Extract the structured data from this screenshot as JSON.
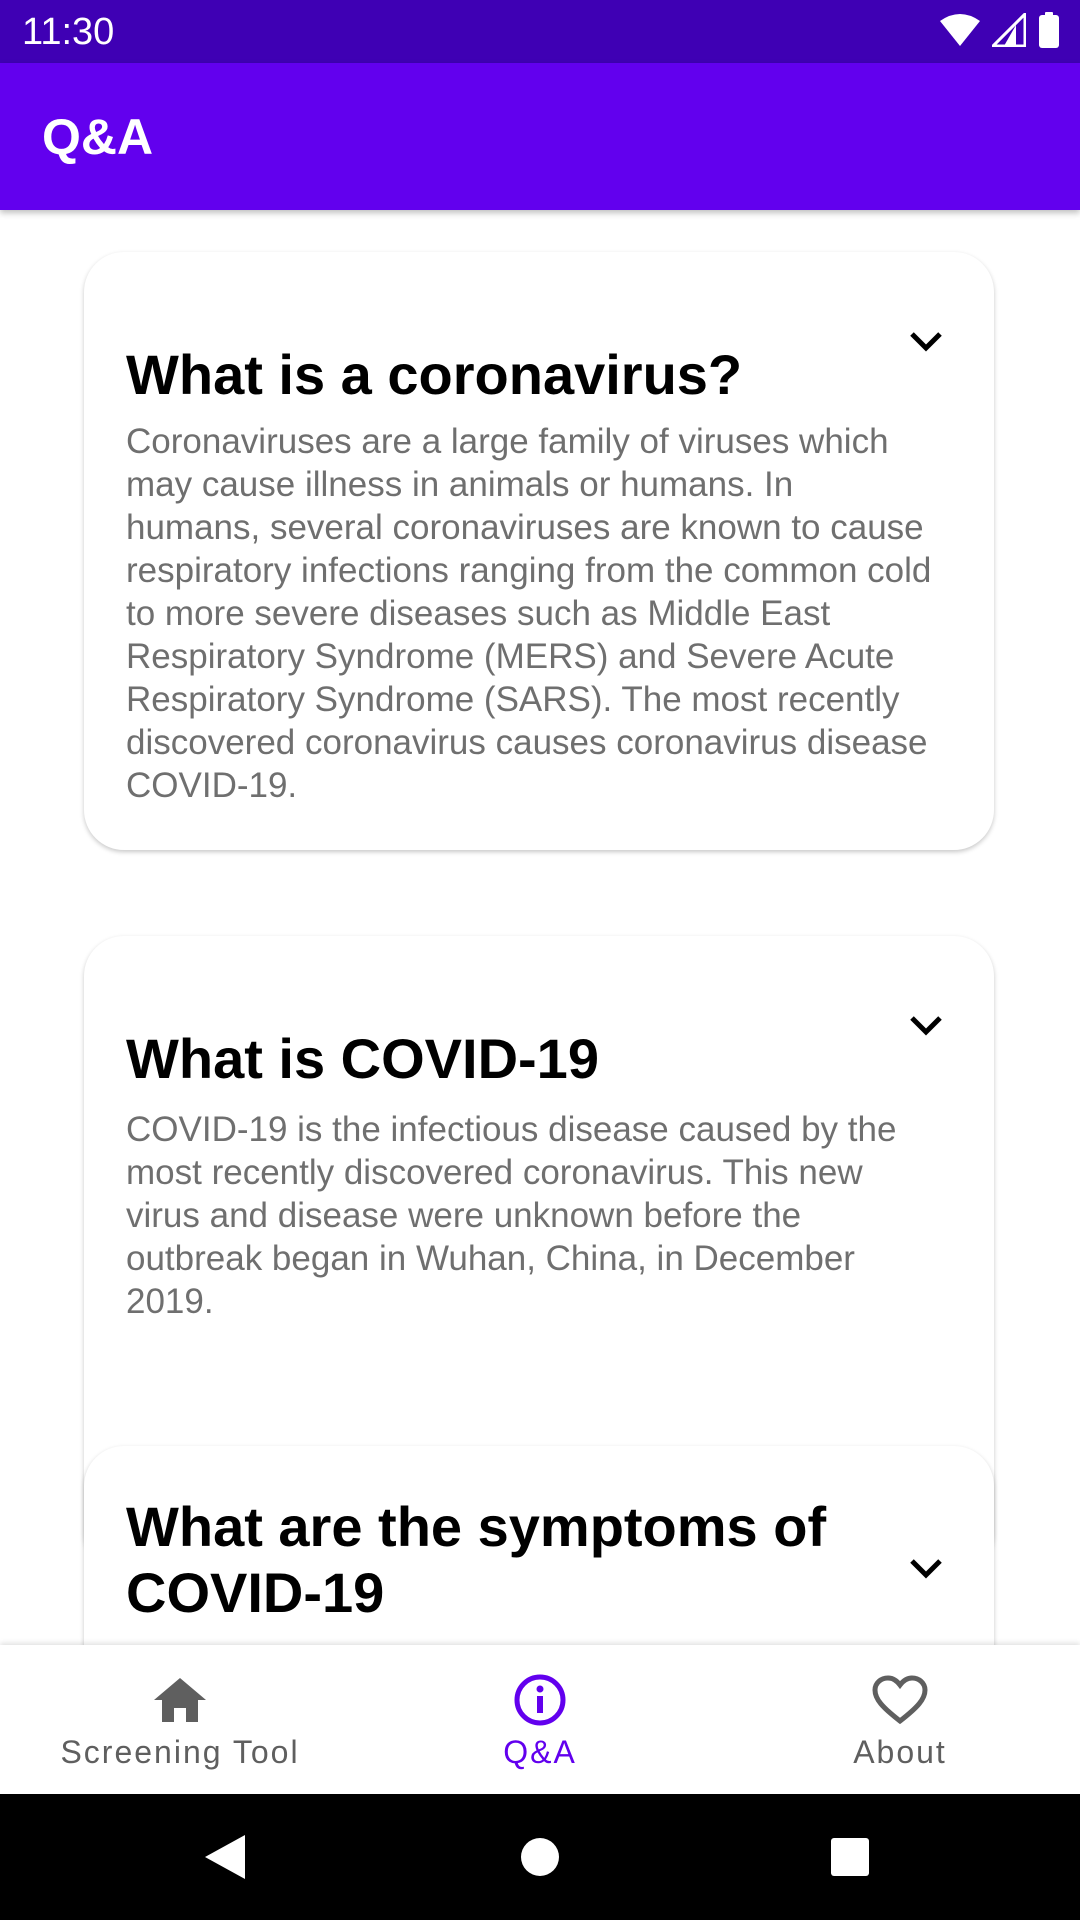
{
  "status_bar": {
    "time": "11:30",
    "icons": [
      "wifi-icon",
      "signal-icon",
      "battery-icon"
    ]
  },
  "app_bar": {
    "title": "Q&A"
  },
  "cards": [
    {
      "title": "What is a coronavirus?",
      "body": "Coronaviruses are a large family of viruses which may cause illness in animals or humans. In humans, several coronaviruses are known to cause respiratory infections ranging from the common cold to more severe diseases such as Middle East Respiratory Syndrome (MERS) and Severe Acute Respiratory Syndrome (SARS). The most recently discovered coronavirus causes coronavirus disease COVID-19.",
      "icon": "chevron-down-icon"
    },
    {
      "title": "What is COVID-19",
      "body": "COVID-19 is the infectious disease caused by the most recently discovered coronavirus. This new virus and disease were unknown before the outbreak began in Wuhan, China, in December 2019.",
      "icon": "chevron-down-icon"
    },
    {
      "title": "What are the symptoms of COVID-19",
      "icon": "chevron-down-icon"
    }
  ],
  "bottom_nav": {
    "items": [
      {
        "label": "Screening Tool",
        "icon": "home-icon",
        "active": false
      },
      {
        "label": "Q&A",
        "icon": "info-icon",
        "active": true
      },
      {
        "label": "About",
        "icon": "heart-icon",
        "active": false
      }
    ]
  },
  "colors": {
    "status_bar": "#3f00b4",
    "app_bar": "#6200ee",
    "nav_active": "#6200ee",
    "nav_inactive": "#5f5f5f",
    "body_text": "#6f6f6f"
  },
  "system_nav": {
    "icons": [
      "back-icon",
      "home-circle-icon",
      "recents-icon"
    ]
  }
}
